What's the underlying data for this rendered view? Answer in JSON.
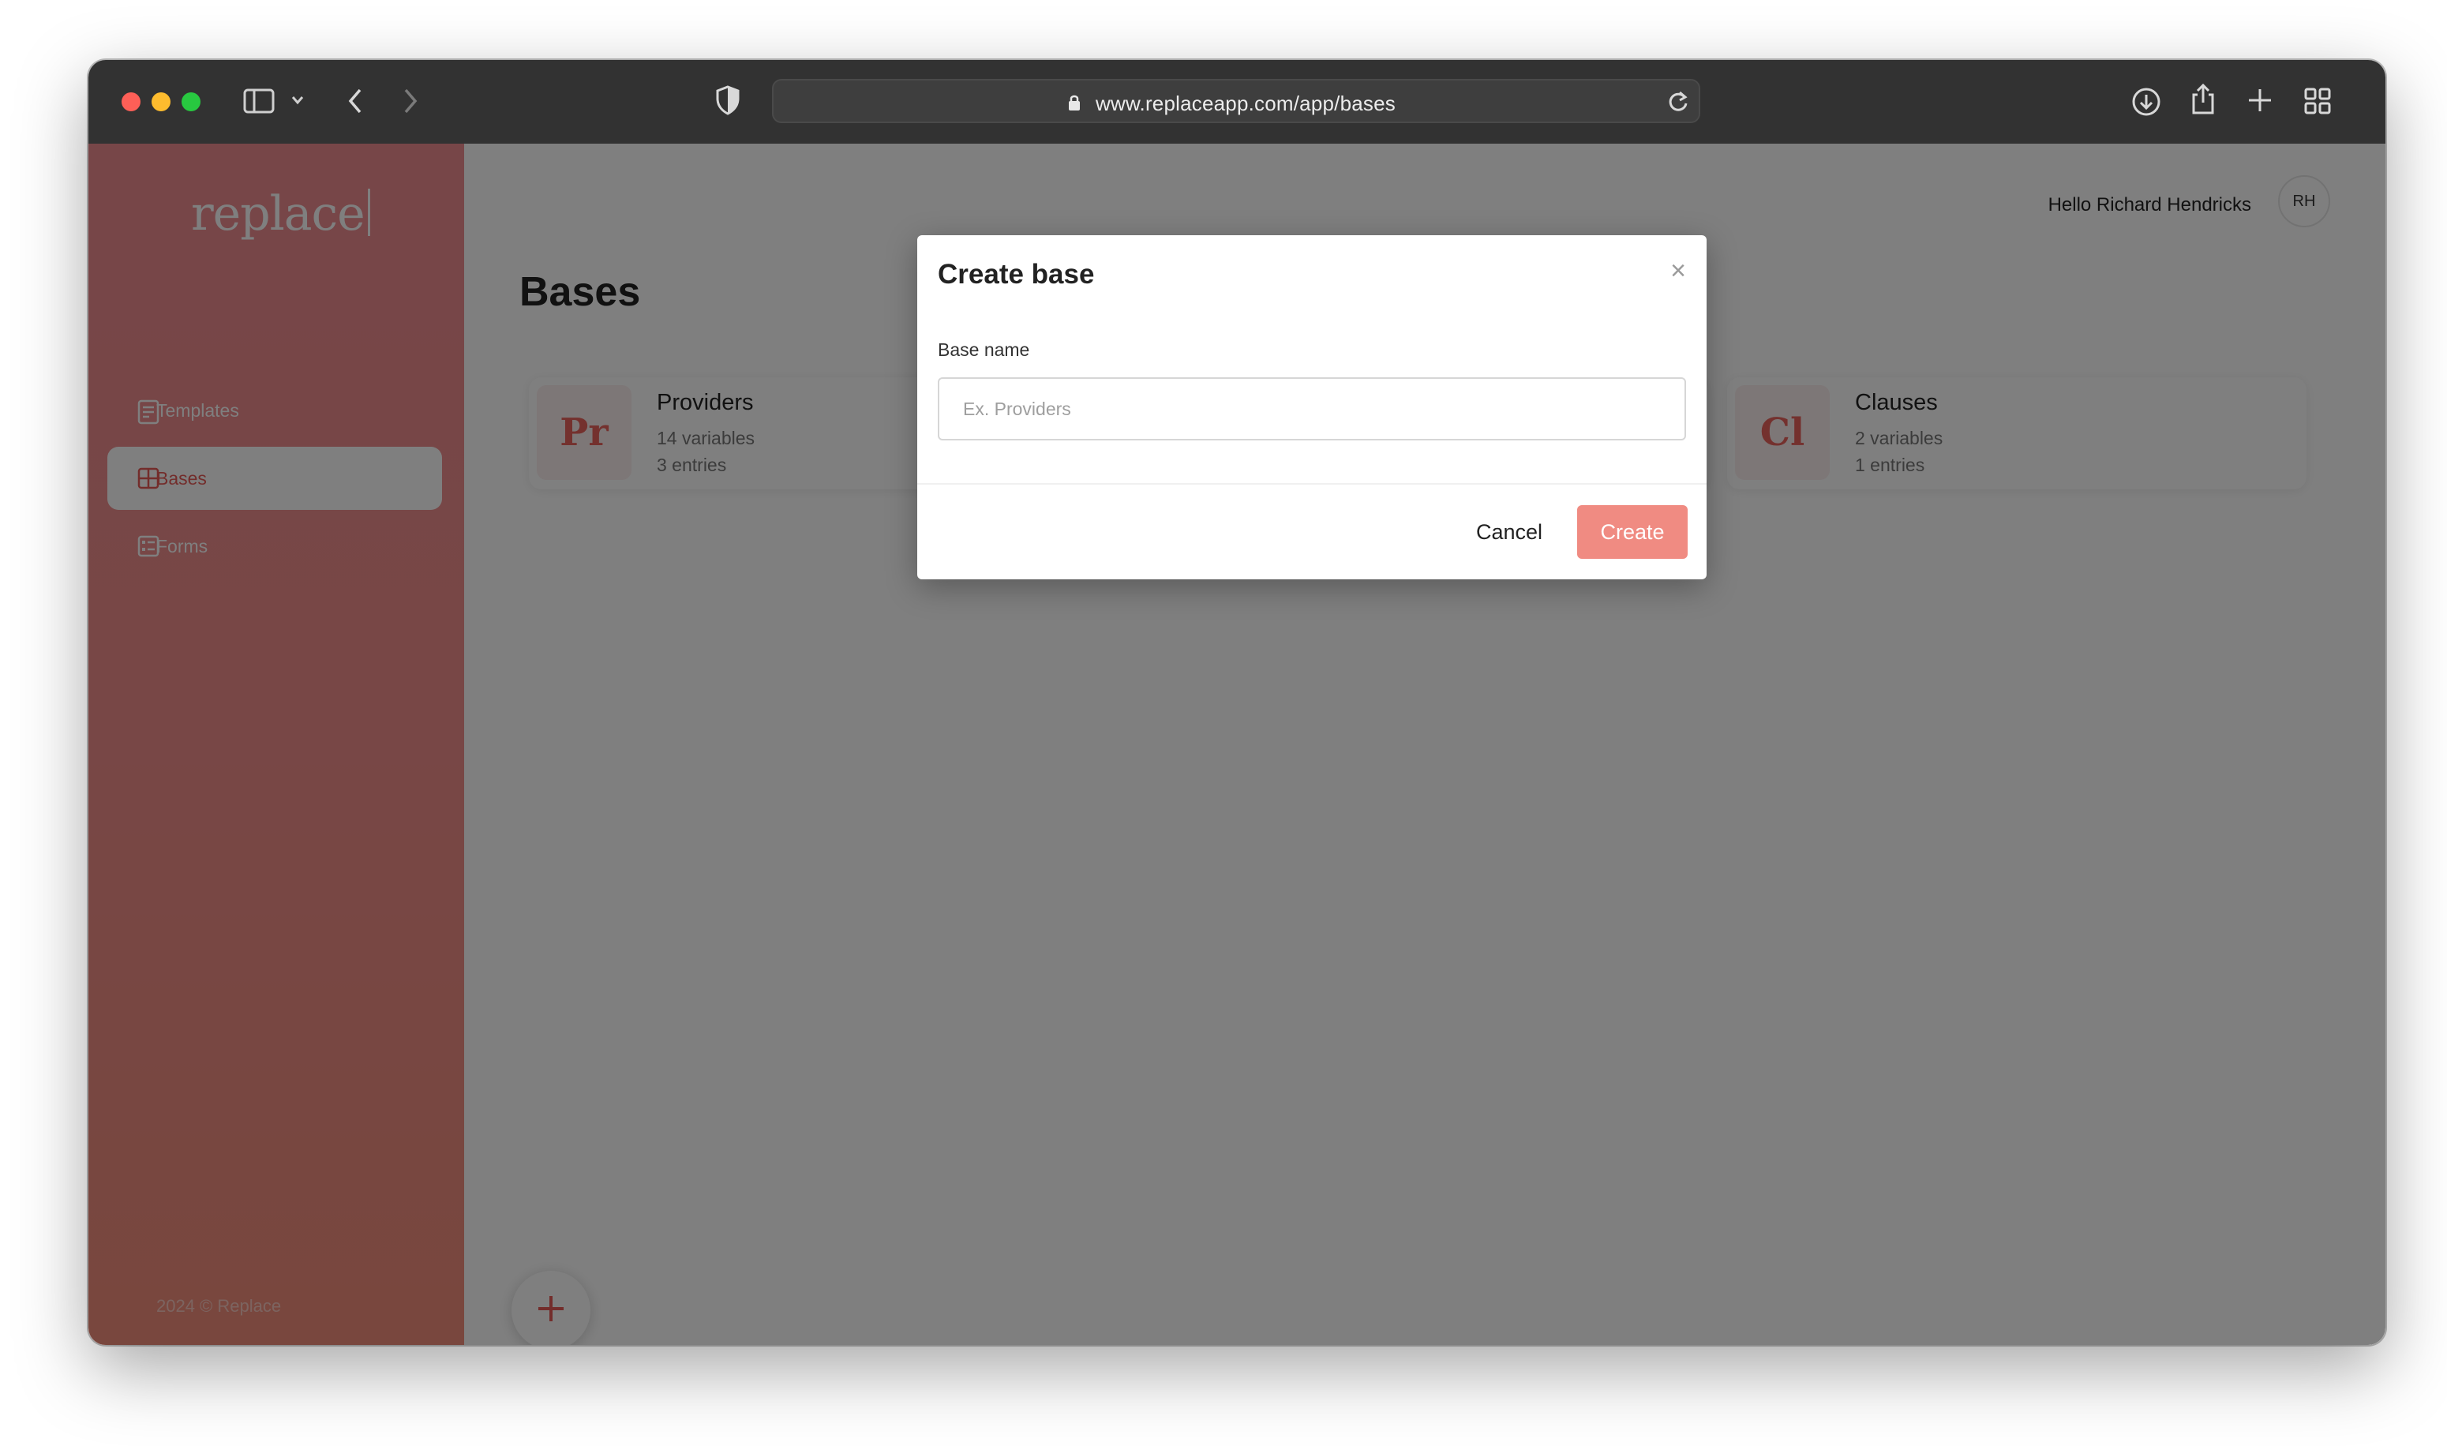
{
  "browser": {
    "url": "www.replaceapp.com/app/bases"
  },
  "sidebar": {
    "logo": "replace",
    "items": [
      {
        "label": "Templates",
        "icon": "template-icon",
        "active": false
      },
      {
        "label": "Bases",
        "icon": "grid-icon",
        "active": true
      },
      {
        "label": "Forms",
        "icon": "form-icon",
        "active": false
      }
    ],
    "footer": "2024 © Replace"
  },
  "header": {
    "greeting": "Hello Richard Hendricks",
    "avatar_initials": "RH"
  },
  "main": {
    "title": "Bases",
    "cards": [
      {
        "badge": "Pr",
        "title": "Providers",
        "variables": "14 variables",
        "entries": "3 entries"
      },
      {
        "badge": "Cl",
        "title": "Clauses",
        "variables": "2 variables",
        "entries": "1 entries"
      }
    ]
  },
  "modal": {
    "title": "Create base",
    "close_label": "×",
    "field_label": "Base name",
    "field_placeholder": "Ex. Providers",
    "field_value": "",
    "cancel_label": "Cancel",
    "create_label": "Create"
  },
  "colors": {
    "accent": "#ef8d86",
    "sidebar_gradient_top": "#ee8c91",
    "sidebar_gradient_bottom": "#f28f7c",
    "titlebar": "#323232"
  }
}
